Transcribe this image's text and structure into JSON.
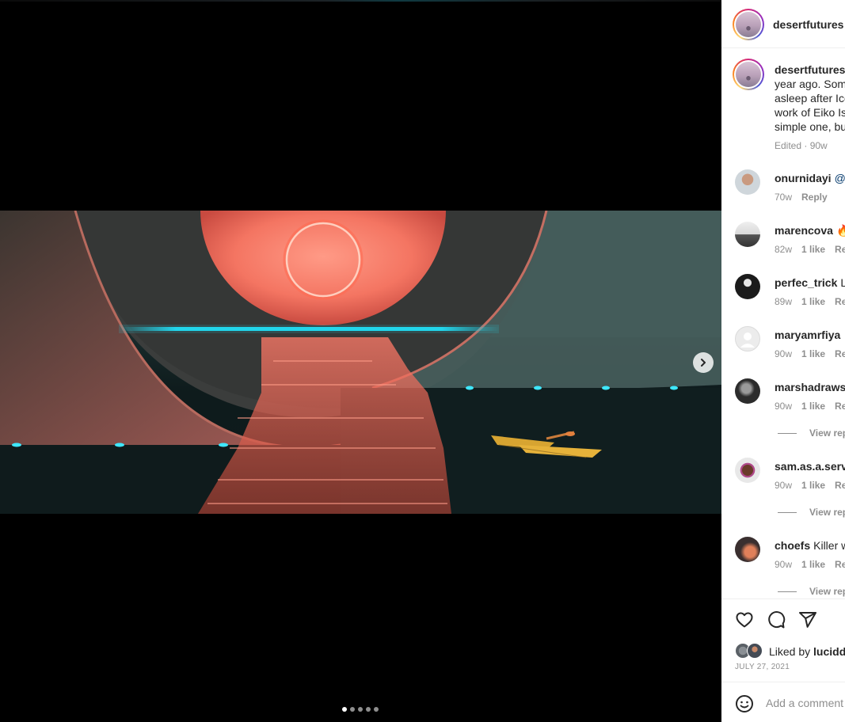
{
  "post": {
    "username": "desertfutures",
    "caption": {
      "username": "desertfutures",
      "text": "’ year ago. Some asleep after Ico work of Eiko Is simple one, bu",
      "meta": "Edited · 90w"
    },
    "carousel": {
      "total": 5,
      "current": 1
    },
    "next_label": "›"
  },
  "comments": [
    {
      "username": "onurnidayi",
      "text": "@n",
      "time": "70w",
      "likes": "",
      "reply": "Reply",
      "avatar_colors": [
        "#cfd6db",
        "#b9917a"
      ]
    },
    {
      "username": "marencova",
      "text": "🔥",
      "time": "82w",
      "likes": "1 like",
      "reply": "Rep",
      "avatar_colors": [
        "#e9e9e9",
        "#3b3b3b"
      ]
    },
    {
      "username": "perfec_trick",
      "text": "Lo",
      "time": "89w",
      "likes": "1 like",
      "reply": "Rep",
      "avatar_colors": [
        "#1b1b1b",
        "#e6e6e6"
      ]
    },
    {
      "username": "maryamrfiya",
      "text": "…",
      "time": "90w",
      "likes": "1 like",
      "reply": "Rep",
      "avatar_colors": [
        "#ececec",
        "#d2d2d2"
      ]
    },
    {
      "username": "marshadraws",
      "text": "",
      "time": "90w",
      "likes": "1 like",
      "reply": "Rep",
      "avatar_colors": [
        "#2c2c2c",
        "#8c8c8c"
      ],
      "view_replies": "View rep"
    },
    {
      "username": "sam.as.a.servic",
      "text": "",
      "time": "90w",
      "likes": "1 like",
      "reply": "Rep",
      "avatar_colors": [
        "#5a2a1f",
        "#b04a8a"
      ],
      "view_replies": "View rep"
    },
    {
      "username": "choefs",
      "text": "Killer w",
      "time": "90w",
      "likes": "1 like",
      "reply": "Rep",
      "avatar_colors": [
        "#3a2f2f",
        "#e0805a"
      ],
      "view_replies": "View rep"
    }
  ],
  "actions": {
    "like": "heart-icon",
    "comment": "comment-icon",
    "share": "share-icon"
  },
  "liked_by": {
    "prefix": "Liked by ",
    "user": "lucidd"
  },
  "date": "JULY 27, 2021",
  "add_comment": {
    "placeholder": "Add a comment"
  },
  "colors": {
    "accent_link": "#00376b",
    "muted": "#8e8e8e",
    "text": "#262626"
  }
}
